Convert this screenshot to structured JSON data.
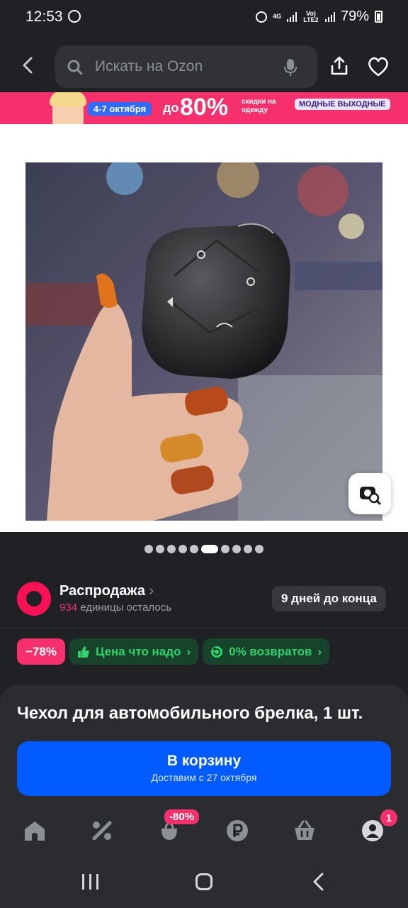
{
  "status_bar": {
    "time": "12:53",
    "network_top": "4G",
    "network_label": "Vo) LTE2",
    "battery": "79%"
  },
  "header": {
    "search_placeholder": "Искать на Ozon",
    "icons": [
      "back-arrow-icon",
      "search-icon",
      "microphone-icon",
      "share-icon",
      "heart-icon"
    ]
  },
  "banner": {
    "dates": "4-7 октября",
    "upto": "до",
    "percent": "80%",
    "discount_text": "скидки на одежду",
    "tag": "МОДНЫЕ ВЫХОДНЫЕ"
  },
  "gallery": {
    "total_images": 10,
    "active_index": 5
  },
  "sale": {
    "title": "Распродажа",
    "chevron": "›",
    "remaining_count": "934",
    "remaining_text": "единицы осталось",
    "days_left": "9 дней до конца"
  },
  "badges": {
    "discount": "−78%",
    "good_price": "Цена что надо",
    "returns": "0% возвратов"
  },
  "product": {
    "title": "Чехол для автомобильного брелка, 1 шт.",
    "cart_label": "В корзину",
    "delivery": "Доставим с 27 октября"
  },
  "tabbar": {
    "promo_badge": "-80%",
    "profile_count": "1",
    "tabs": [
      "home-icon",
      "percent-icon",
      "fresh-icon",
      "ruble-icon",
      "basket-icon",
      "profile-icon"
    ]
  },
  "colors": {
    "background": "#1f2124",
    "accent_pink": "#f5306c",
    "accent_blue": "#005bff",
    "accent_green": "#2fd26b"
  }
}
